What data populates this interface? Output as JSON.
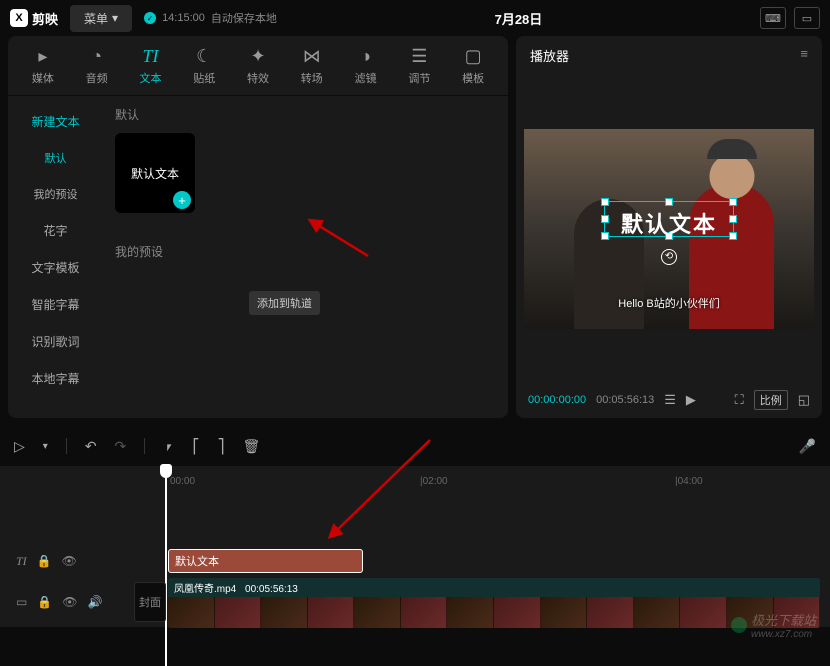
{
  "topbar": {
    "app_name": "剪映",
    "menu_label": "菜单",
    "save_time": "14:15:00",
    "save_text": "自动保存本地",
    "title": "7月28日"
  },
  "tabs": {
    "items": [
      {
        "label": "媒体",
        "icon": "▸"
      },
      {
        "label": "音频",
        "icon": "◔"
      },
      {
        "label": "文本",
        "icon": "TI"
      },
      {
        "label": "贴纸",
        "icon": "☾"
      },
      {
        "label": "特效",
        "icon": "✦"
      },
      {
        "label": "转场",
        "icon": "⋈"
      },
      {
        "label": "滤镜",
        "icon": "◑"
      },
      {
        "label": "调节",
        "icon": "≡"
      },
      {
        "label": "模板",
        "icon": "▢"
      }
    ]
  },
  "sidebar": {
    "items": [
      {
        "label": "新建文本"
      },
      {
        "label": "默认"
      },
      {
        "label": "我的预设"
      },
      {
        "label": "花字"
      },
      {
        "label": "文字模板"
      },
      {
        "label": "智能字幕"
      },
      {
        "label": "识别歌词"
      },
      {
        "label": "本地字幕"
      }
    ]
  },
  "content": {
    "section_default": "默认",
    "card_text": "默认文本",
    "tooltip": "添加到轨道",
    "section_preset": "我的预设"
  },
  "player": {
    "title": "播放器",
    "overlay_text": "默认文本",
    "subtitle": "Hello B站的小伙伴们",
    "time_current": "00:00:00:00",
    "time_total": "00:05:56:13",
    "ratio_label": "比例"
  },
  "timeline": {
    "marks": [
      "00:00",
      "|02:00",
      "|04:00"
    ],
    "text_clip_label": "默认文本",
    "video_clip_name": "凤凰传奇.mp4",
    "video_clip_duration": "00:05:56:13",
    "cover_label": "封面",
    "track_text_icon": "TI"
  },
  "watermark": {
    "text": "极光下载站",
    "url": "www.xz7.com"
  }
}
